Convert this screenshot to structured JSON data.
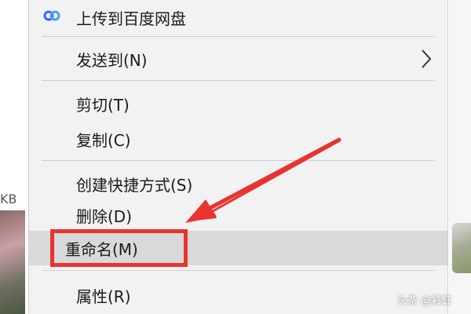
{
  "background": {
    "left_partial_text": "KB",
    "watermark": "头条 @彩虹"
  },
  "menu": {
    "items": [
      {
        "label": "上传到百度网盘",
        "icon": "baidu-netdisk-icon"
      },
      {
        "label": "发送到(N)",
        "submenu": true
      },
      {
        "label": "剪切(T)"
      },
      {
        "label": "复制(C)"
      },
      {
        "label": "创建快捷方式(S)"
      },
      {
        "label": "删除(D)"
      },
      {
        "label": "重命名(M)",
        "highlighted": true
      },
      {
        "label": "属性(R)"
      }
    ]
  },
  "annotation": {
    "color": "#e8332f",
    "target": "重命名(M)"
  },
  "colors": {
    "menu_bg": "#f2f2f2",
    "highlight_bg": "#d9d9d9",
    "baidu_blue": "#2f6fe8"
  }
}
